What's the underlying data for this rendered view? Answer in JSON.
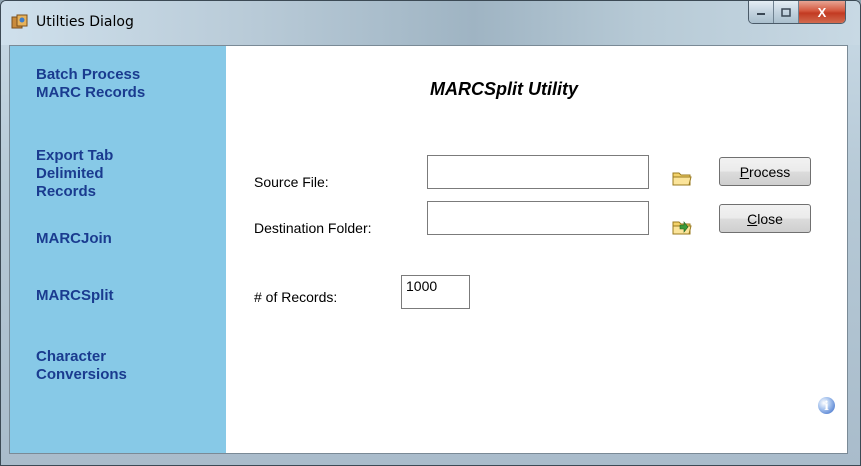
{
  "window": {
    "title": "Utilties Dialog",
    "minimize_icon": "minimize-icon",
    "maximize_icon": "maximize-icon",
    "close_label": "X"
  },
  "sidebar": {
    "items": [
      {
        "label": "Batch Process MARC Records"
      },
      {
        "label": "Export Tab Delimited Records"
      },
      {
        "label": "MARCJoin"
      },
      {
        "label": "MARCSplit"
      },
      {
        "label": "Character Conversions"
      }
    ]
  },
  "main": {
    "title": "MARCSplit Utility",
    "source_file": {
      "label": "Source File:",
      "value": ""
    },
    "destination_folder": {
      "label": "Destination Folder:",
      "value": ""
    },
    "records": {
      "label": "# of Records:",
      "value": "1000"
    }
  },
  "buttons": {
    "process": {
      "accel": "P",
      "rest": "rocess"
    },
    "close": {
      "accel": "C",
      "rest": "lose"
    }
  },
  "icons": {
    "app": "app-icon",
    "source_browse": "folder-open-icon",
    "destination_browse": "folder-browse-icon",
    "info": "info-icon"
  },
  "colors": {
    "sidebar_bg": "#87c9e7",
    "link_text": "#1a3b8f",
    "close_button": "#c8432a"
  }
}
